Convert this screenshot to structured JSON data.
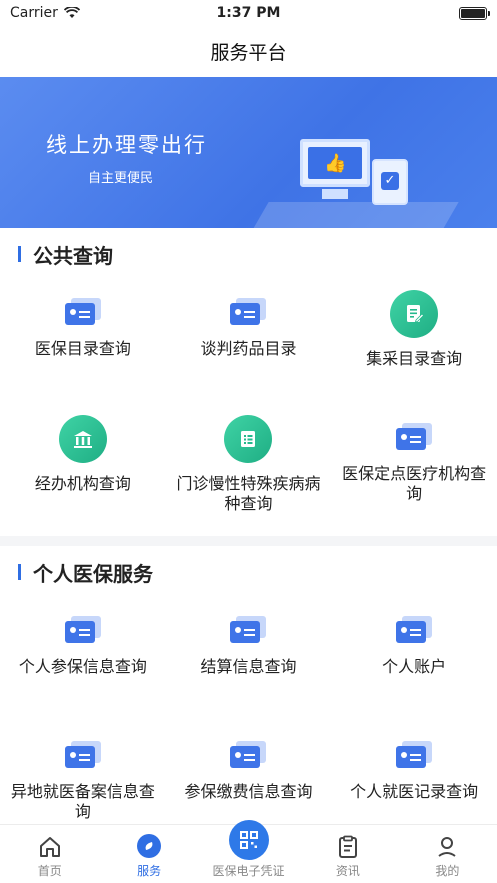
{
  "status_bar": {
    "carrier": "Carrier",
    "time": "1:37 PM"
  },
  "nav": {
    "title": "服务平台"
  },
  "banner": {
    "title": "线上办理零出行",
    "subtitle": "自主更便民"
  },
  "public_query": {
    "title": "公共查询",
    "items": [
      {
        "label": "医保目录查询",
        "icon": "card-icon"
      },
      {
        "label": "谈判药品目录",
        "icon": "card-icon"
      },
      {
        "label": "集采目录查询",
        "icon": "document-edit-icon"
      },
      {
        "label": "经办机构查询",
        "icon": "bank-icon"
      },
      {
        "label": "门诊慢性特殊疾病病种查询",
        "icon": "list-icon"
      },
      {
        "label": "医保定点医疗机构查询",
        "icon": "card-icon"
      }
    ]
  },
  "personal_service": {
    "title": "个人医保服务",
    "items": [
      {
        "label": "个人参保信息查询",
        "icon": "card-icon"
      },
      {
        "label": "结算信息查询",
        "icon": "card-icon"
      },
      {
        "label": "个人账户",
        "icon": "card-icon"
      },
      {
        "label": "异地就医备案信息查询",
        "icon": "card-icon"
      },
      {
        "label": "参保缴费信息查询",
        "icon": "card-icon"
      },
      {
        "label": "个人就医记录查询",
        "icon": "card-icon"
      }
    ]
  },
  "tabbar": {
    "tabs": [
      {
        "label": "首页",
        "icon": "home-icon"
      },
      {
        "label": "服务",
        "icon": "compass-icon",
        "active": true
      },
      {
        "label": "医保电子凭证",
        "icon": "qrcode-icon"
      },
      {
        "label": "资讯",
        "icon": "clipboard-icon"
      },
      {
        "label": "我的",
        "icon": "user-icon"
      }
    ]
  },
  "colors": {
    "accent": "#2f6ee3",
    "green": "#25b98d",
    "banner": "#4a80ec"
  }
}
